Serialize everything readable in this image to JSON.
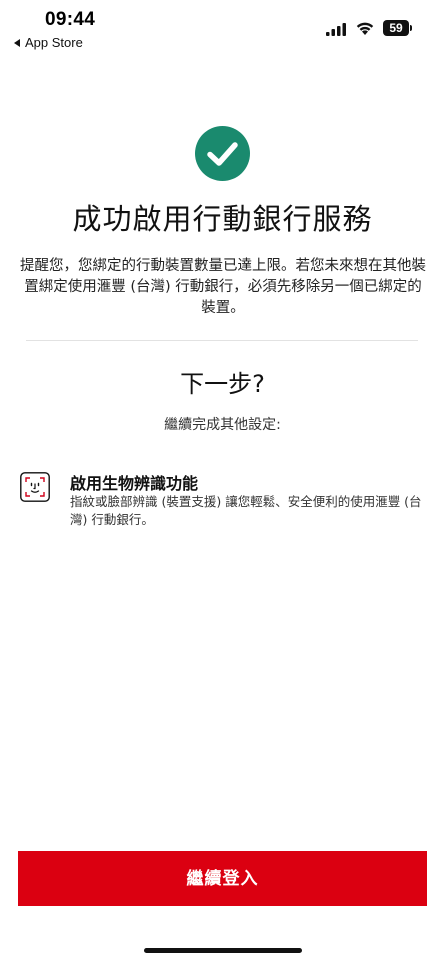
{
  "status_bar": {
    "time": "09:44",
    "back_app_label": "App Store",
    "battery_level": "59"
  },
  "success": {
    "icon": "checkmark-circle-icon",
    "icon_color": "#1a8a6e",
    "title": "成功啟用行動銀行服務",
    "reminder": "提醒您，您綁定的行動裝置數量已達上限。若您未來想在其他裝置綁定使用滙豐 (台灣) 行動銀行，必須先移除另一個已綁定的裝置。"
  },
  "next_steps": {
    "heading": "下一步?",
    "subtitle": "繼續完成其他設定:"
  },
  "options": [
    {
      "icon": "face-id-icon",
      "title": "啟用生物辨識功能",
      "description": "指紋或臉部辨識 (裝置支援) 讓您輕鬆、安全便利的使用滙豐 (台灣) 行動銀行。"
    }
  ],
  "actions": {
    "continue_label": "繼續登入",
    "continue_color": "#db0011"
  }
}
